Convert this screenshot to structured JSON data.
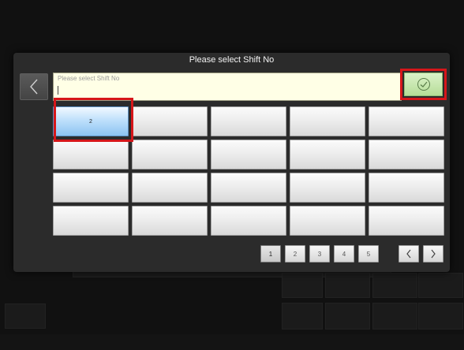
{
  "modal": {
    "title": "Please select Shift No",
    "input_placeholder": "Please select Shift No",
    "input_value": ""
  },
  "shift_grid": {
    "cells": [
      "2",
      "",
      "",
      "",
      "",
      "",
      "",
      "",
      "",
      "",
      "",
      "",
      "",
      "",
      "",
      "",
      "",
      "",
      "",
      ""
    ],
    "selected_index": 0
  },
  "pager": {
    "pages": [
      "1",
      "2",
      "3",
      "4",
      "5"
    ],
    "current_page": "1"
  },
  "colors": {
    "highlight": "#d6161a",
    "selected_cell": "#8cc4f2",
    "confirm": "#b6dd98",
    "input_bg": "#ffffe6"
  },
  "icons": {
    "back": "chevron-left-icon",
    "confirm": "check-circle-icon",
    "prev": "chevron-left-icon",
    "next": "chevron-right-icon"
  }
}
